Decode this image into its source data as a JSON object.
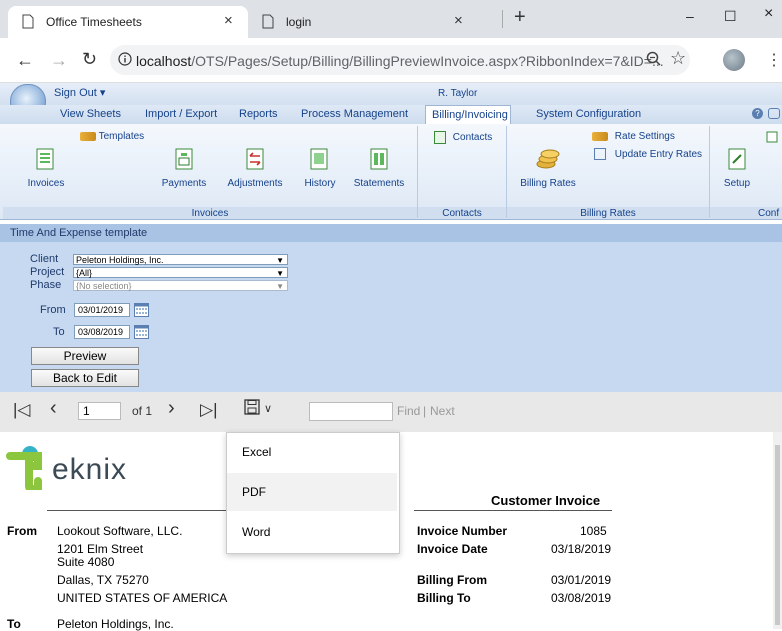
{
  "browser": {
    "tabs": [
      {
        "title": "Office Timesheets",
        "close": "×"
      },
      {
        "title": "login",
        "close": "×"
      }
    ],
    "new_tab": "+",
    "window": {
      "minimize": "–",
      "maximize": "☐",
      "close": "×"
    },
    "url_host": "localhost",
    "url_path": "/OTS/Pages/Setup/Billing/BillingPreviewInvoice.aspx?RibbonIndex=7&ID=..."
  },
  "ribbon": {
    "sign_out": "Sign Out",
    "user": "R. Taylor",
    "tabs": [
      "View Sheets",
      "Import / Export",
      "Reports",
      "Process Management",
      "Billing/Invoicing",
      "System Configuration"
    ],
    "groups": {
      "invoices": {
        "label": "Invoices",
        "templates": "Templates",
        "buttons": [
          "Invoices",
          "Payments",
          "Adjustments",
          "History",
          "Statements"
        ]
      },
      "contacts": {
        "label": "Contacts",
        "button": "Contacts"
      },
      "billing_rates": {
        "label": "Billing Rates",
        "button": "Billing Rates",
        "rate_settings": "Rate Settings",
        "update_entry_rates": "Update Entry Rates"
      },
      "config": {
        "label": "Conf",
        "button": "Setup"
      }
    }
  },
  "form": {
    "template_title": "Time And Expense template",
    "client_label": "Client",
    "client_value": "Peleton Holdings, Inc.",
    "project_label": "Project",
    "project_value": "{All}",
    "phase_label": "Phase",
    "phase_value": "{No selection}",
    "from_label": "From",
    "from_value": "03/01/2019",
    "to_label": "To",
    "to_value": "03/08/2019",
    "preview_button": "Preview",
    "back_button": "Back to Edit"
  },
  "report_toolbar": {
    "page_value": "1",
    "of_pages": "of 1",
    "find_label": "Find",
    "separator": "|",
    "next_label": "Next",
    "find_value": ""
  },
  "export_menu": [
    "Excel",
    "PDF",
    "Word"
  ],
  "invoice": {
    "logo_text": "eknix",
    "title": "Customer Invoice",
    "from_label": "From",
    "from_lines": [
      "Lookout Software, LLC.",
      "1201 Elm Street",
      "Suite 4080",
      "Dallas, TX 75270",
      "UNITED STATES OF AMERICA"
    ],
    "to_label": "To",
    "to_value": "Peleton Holdings, Inc.",
    "fields": [
      {
        "label": "Invoice Number",
        "value": "1085"
      },
      {
        "label": "Invoice Date",
        "value": "03/18/2019"
      },
      {
        "label": "Billing From",
        "value": "03/01/2019"
      },
      {
        "label": "Billing To",
        "value": "03/08/2019"
      }
    ]
  }
}
